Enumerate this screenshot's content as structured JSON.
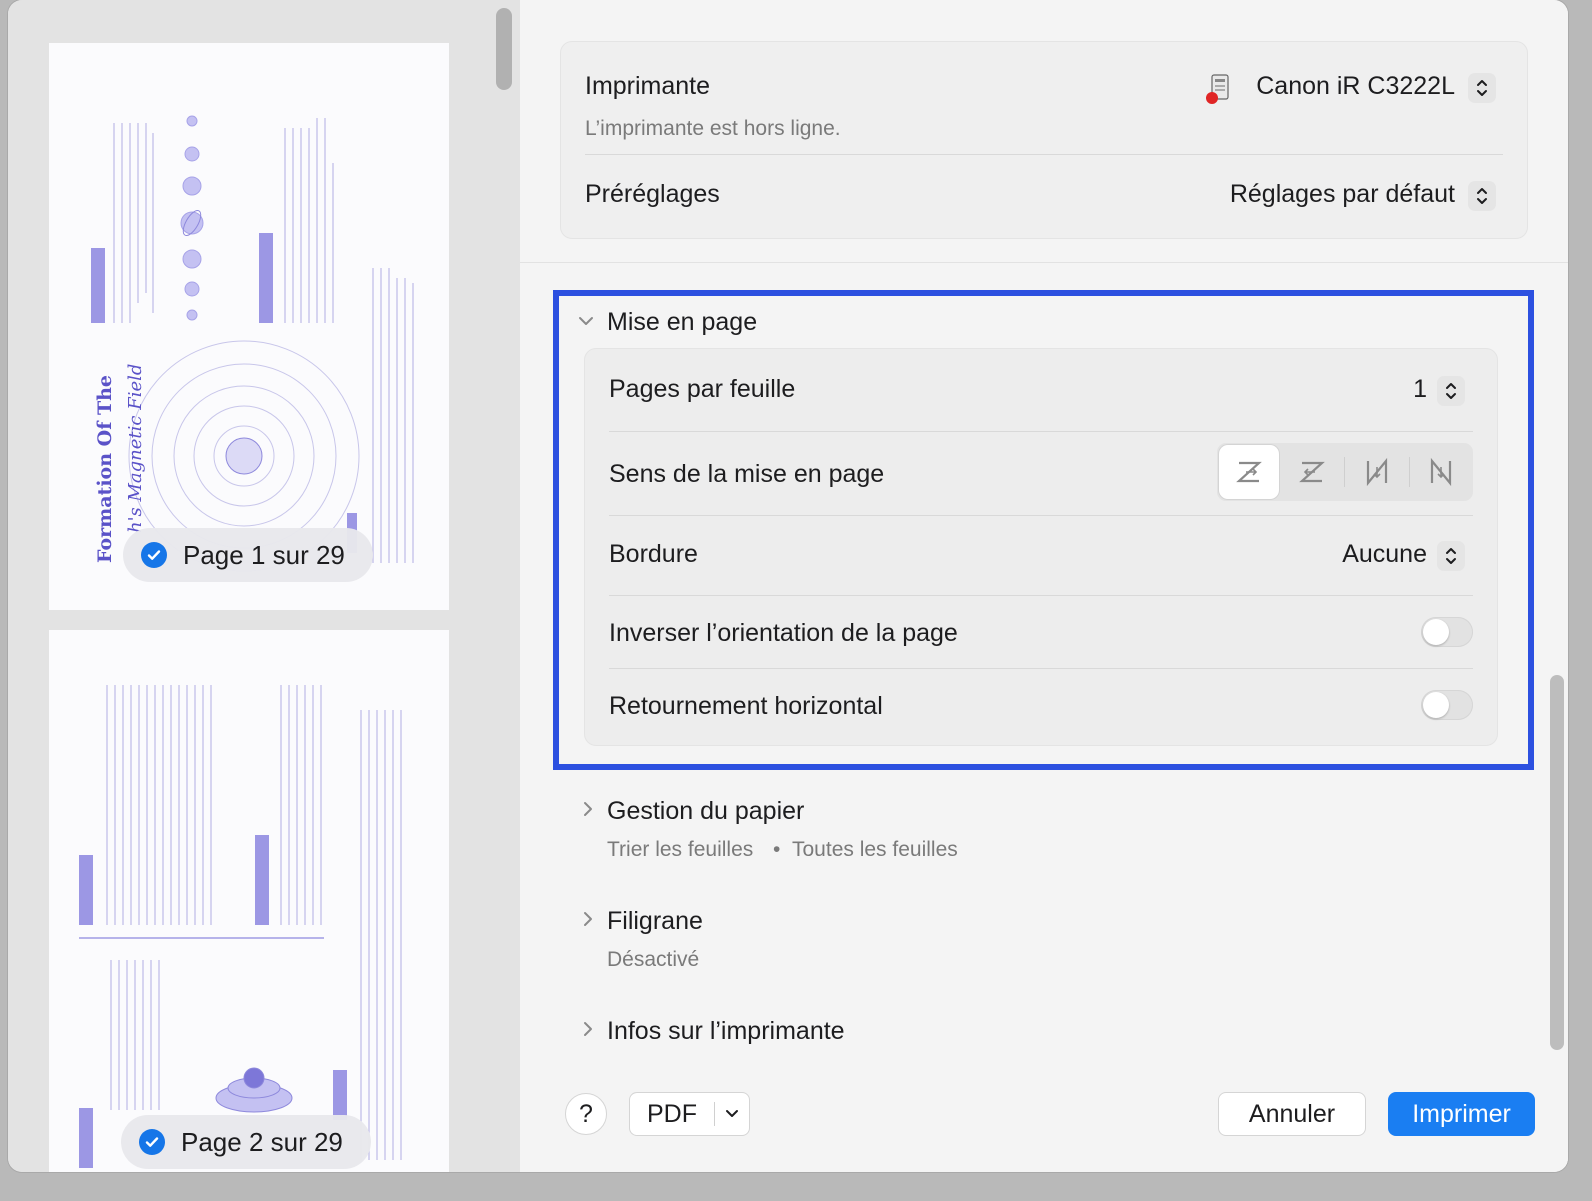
{
  "preview": {
    "pages": [
      {
        "label": "Page 1 sur 29",
        "selected": true
      },
      {
        "label": "Page 2 sur 29",
        "selected": true
      }
    ]
  },
  "printer": {
    "label": "Imprimante",
    "name": "Canon iR C3222L",
    "status": "L’imprimante est hors ligne."
  },
  "presets": {
    "label": "Préréglages",
    "value": "Réglages par défaut"
  },
  "layout": {
    "title": "Mise en page",
    "expanded": true,
    "pages_per_sheet_label": "Pages par feuille",
    "pages_per_sheet_value": "1",
    "direction_label": "Sens de la mise en page",
    "direction_options": [
      "z-forward-icon",
      "z-reverse-icon",
      "n-reverse-icon",
      "n-forward-icon"
    ],
    "direction_selected": 0,
    "border_label": "Bordure",
    "border_value": "Aucune",
    "reverse_orientation_label": "Inverser l’orientation de la page",
    "reverse_orientation_on": false,
    "flip_horizontal_label": "Retournement horizontal",
    "flip_horizontal_on": false,
    "highlight_color": "#2c50e0"
  },
  "paper": {
    "title": "Gestion du papier",
    "summary_a": "Trier les feuilles",
    "summary_sep": "•",
    "summary_b": "Toutes les feuilles"
  },
  "watermark": {
    "title": "Filigrane",
    "summary": "Désactivé"
  },
  "printer_info": {
    "title": "Infos sur l’imprimante"
  },
  "footer": {
    "help_label": "?",
    "pdf_label": "PDF",
    "cancel_label": "Annuler",
    "print_label": "Imprimer",
    "accent_color": "#1a7ef2"
  }
}
